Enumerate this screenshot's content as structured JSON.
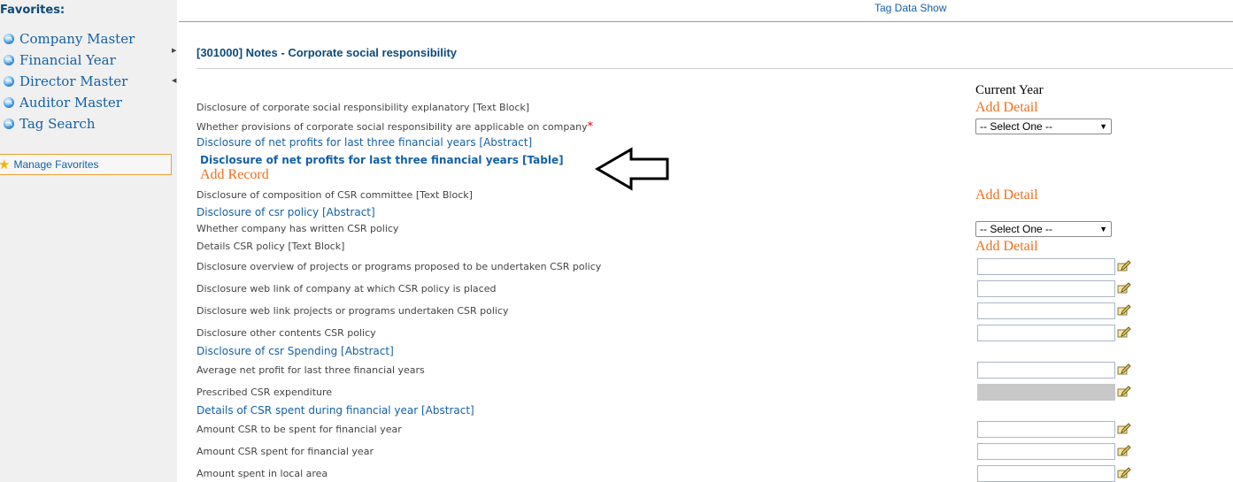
{
  "sidebar": {
    "title": "Favorites:",
    "items": [
      {
        "label": "Company Master",
        "icon": "arrow-circle-icon"
      },
      {
        "label": "Financial Year",
        "icon": "arrow-circle-icon"
      },
      {
        "label": "Director Master",
        "icon": "arrow-circle-icon"
      },
      {
        "label": "Auditor Master",
        "icon": "arrow-circle-icon"
      },
      {
        "label": "Tag Search",
        "icon": "arrow-circle-icon"
      }
    ],
    "manage_favorites": "Manage Favorites"
  },
  "header": {
    "tag_data_show": "Tag Data Show"
  },
  "section": {
    "title": "[301000] Notes - Corporate social responsibility",
    "column_header": "Current Year"
  },
  "rows": {
    "r1": {
      "label": "Disclosure of corporate social responsibility explanatory [Text Block]",
      "action": "Add Detail"
    },
    "r2": {
      "label": "Whether provisions of corporate social responsibility are applicable on company",
      "required_mark": "*",
      "select": "-- Select One --"
    },
    "r3": {
      "label": "Disclosure of net profits for last three financial years [Abstract]"
    },
    "r4": {
      "label": "Disclosure of net profits for last three financial years [Table]",
      "action": "Add Record"
    },
    "r5": {
      "label": "Disclosure of composition of CSR committee [Text Block]",
      "action": "Add Detail"
    },
    "r6": {
      "label": "Disclosure of csr policy [Abstract]"
    },
    "r7": {
      "label": "Whether company has written CSR policy",
      "select": "-- Select One --"
    },
    "r8": {
      "label": "Details CSR policy [Text Block]",
      "action": "Add Detail"
    },
    "r9": {
      "label": "Disclosure overview of projects or programs proposed to be undertaken CSR policy",
      "value": ""
    },
    "r10": {
      "label": "Disclosure web link of company at which CSR policy is placed",
      "value": ""
    },
    "r11": {
      "label": "Disclosure web link projects or programs undertaken CSR policy",
      "value": ""
    },
    "r12": {
      "label": "Disclosure other contents CSR policy",
      "value": ""
    },
    "r13": {
      "label": "Disclosure of csr Spending [Abstract]"
    },
    "r14": {
      "label": "Average net profit for last three financial years",
      "value": ""
    },
    "r15": {
      "label": "Prescribed CSR expenditure",
      "value": "",
      "disabled": true
    },
    "r16": {
      "label": "Details of CSR spent during financial year [Abstract]"
    },
    "r17": {
      "label": "Amount CSR to be spent for financial year",
      "value": ""
    },
    "r18": {
      "label": "Amount CSR spent for financial year",
      "value": ""
    },
    "r19": {
      "label": "Amount spent in local area",
      "value": ""
    }
  },
  "annotation": {
    "icon": "left-arrow-outline-icon"
  },
  "colors": {
    "link": "#1560a6",
    "action": "#ee6f1d",
    "title": "#0b4a7c",
    "required": "#dd0000"
  }
}
